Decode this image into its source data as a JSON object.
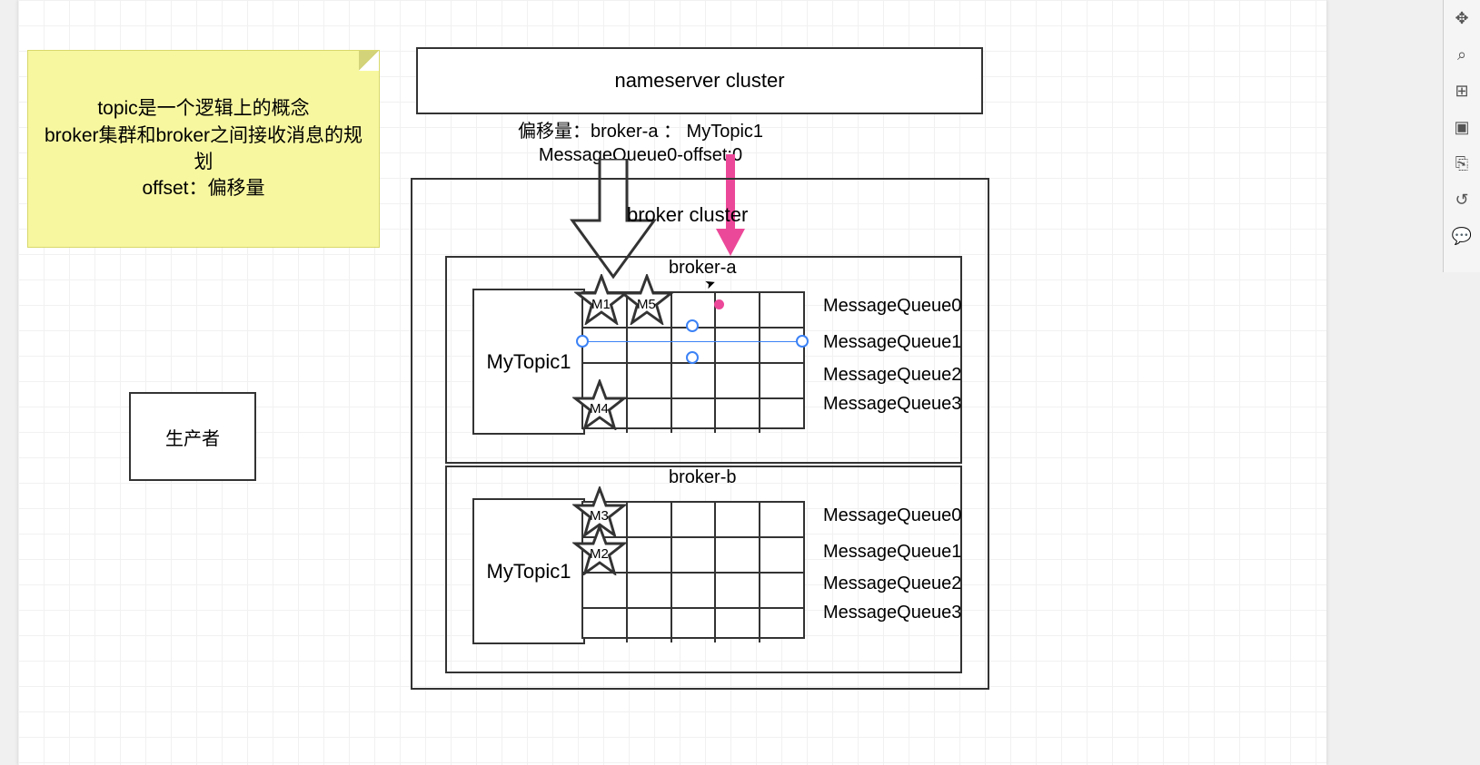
{
  "note": {
    "line1": "topic是一个逻辑上的概念",
    "line2": "broker集群和broker之间接收消息的规划",
    "line3": "offset：偏移量"
  },
  "nameserver": "nameserver cluster",
  "offset_text": {
    "l1": "偏移量：broker-a ： MyTopic1",
    "l2": "MessageQueue0-offset:0"
  },
  "broker_cluster": "broker cluster",
  "brokerA": {
    "title": "broker-a",
    "topic": "MyTopic1",
    "queues": [
      "MessageQueue0",
      "MessageQueue1",
      "MessageQueue2",
      "MessageQueue3"
    ],
    "stars": {
      "m1": "M1",
      "m5": "M5",
      "m4": "M4"
    }
  },
  "brokerB": {
    "title": "broker-b",
    "topic": "MyTopic1",
    "queues": [
      "MessageQueue0",
      "MessageQueue1",
      "MessageQueue2",
      "MessageQueue3"
    ],
    "stars": {
      "m3": "M3",
      "m2": "M2"
    }
  },
  "producer": "生产者",
  "toolbar": [
    "✥",
    "⌕",
    "⊞",
    "▣",
    "⎘",
    "↺",
    "💬"
  ]
}
